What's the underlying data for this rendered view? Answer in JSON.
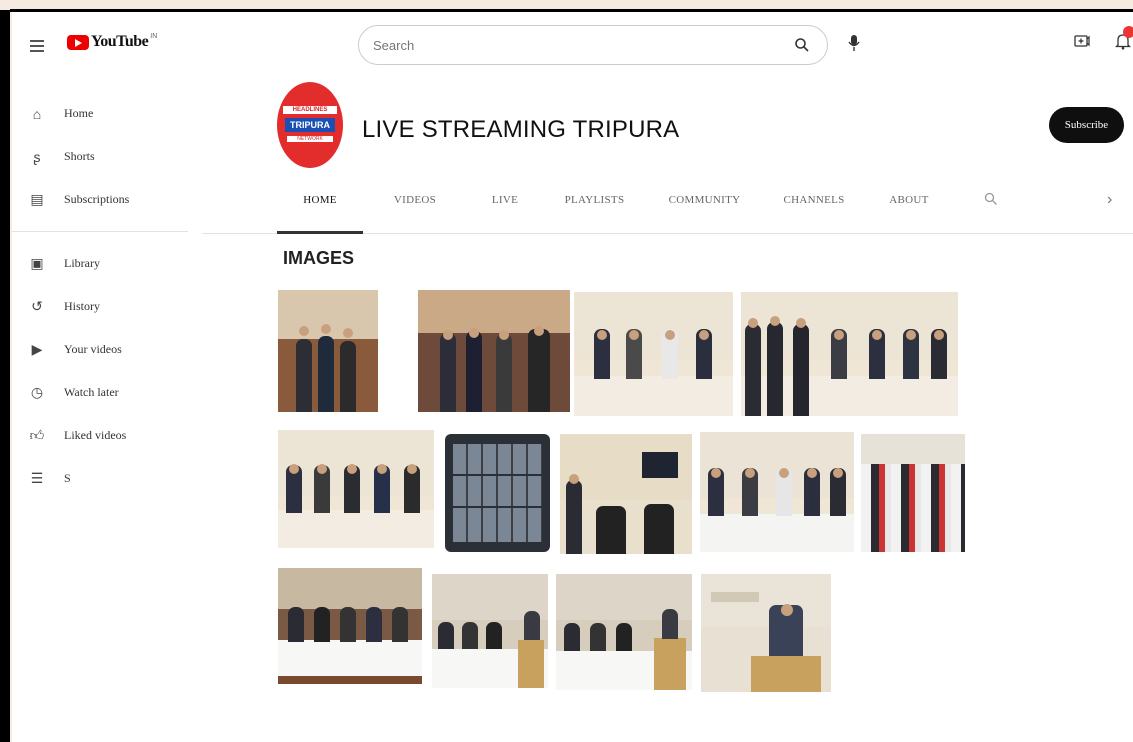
{
  "header": {
    "logo_text": "YouTube",
    "logo_sup": "IN",
    "search_placeholder": "Search"
  },
  "sidebar": {
    "items": [
      {
        "label": "Home",
        "icon": "home-icon"
      },
      {
        "label": "Shorts",
        "icon": "shorts-icon"
      },
      {
        "label": "Subscriptions",
        "icon": "subscriptions-icon"
      }
    ],
    "library_items": [
      {
        "label": "Library",
        "icon": "library-icon"
      },
      {
        "label": "History",
        "icon": "history-icon"
      },
      {
        "label": "Your videos",
        "icon": "your-videos-icon"
      },
      {
        "label": "Watch later",
        "icon": "watch-later-icon"
      },
      {
        "label": "Liked videos",
        "icon": "liked-videos-icon"
      },
      {
        "label": "S",
        "icon": "playlist-icon"
      }
    ]
  },
  "channel": {
    "name": "LIVE STREAMING TRIPURA",
    "avatar_line1": "HEADLINES",
    "avatar_line2": "TRIPURA",
    "avatar_line3": "NETWORK",
    "subscribe_label": "Subscribe"
  },
  "tabs": [
    "HOME",
    "VIDEOS",
    "LIVE",
    "PLAYLISTS",
    "COMMUNITY",
    "CHANNELS",
    "ABOUT"
  ],
  "active_tab": "HOME",
  "section": {
    "title": "IMAGES"
  },
  "colors": {
    "brand_red": "#e00000",
    "subscribe_bg": "#0f0f0f",
    "avatar_red": "#e32d2d",
    "avatar_blue": "#1b4fb4"
  }
}
